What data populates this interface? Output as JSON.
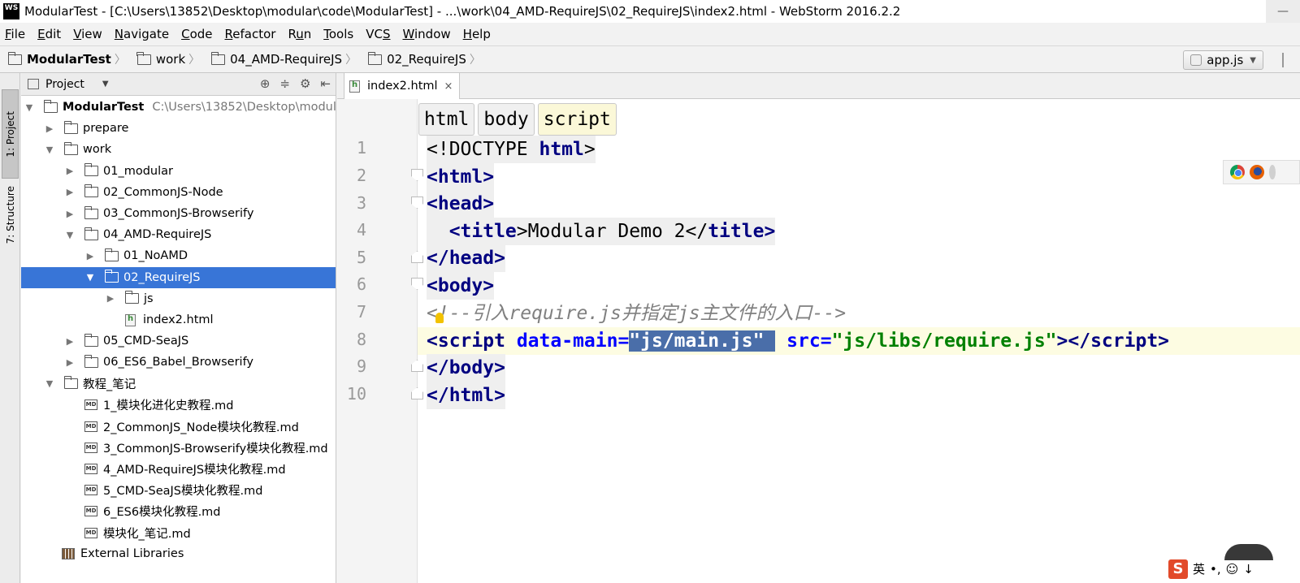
{
  "window": {
    "logo": "WS",
    "title": "ModularTest - [C:\\Users\\13852\\Desktop\\modular\\code\\ModularTest] - ...\\work\\04_AMD-RequireJS\\02_RequireJS\\index2.html - WebStorm 2016.2.2",
    "control": "—"
  },
  "menu": [
    {
      "u": "F",
      "rest": "ile"
    },
    {
      "u": "E",
      "rest": "dit"
    },
    {
      "u": "V",
      "rest": "iew"
    },
    {
      "u": "N",
      "rest": "avigate"
    },
    {
      "u": "C",
      "rest": "ode"
    },
    {
      "u": "R",
      "rest": "efactor"
    },
    {
      "pre": "R",
      "u": "u",
      "rest": "n"
    },
    {
      "u": "T",
      "rest": "ools"
    },
    {
      "pre": "VC",
      "u": "S",
      "rest": ""
    },
    {
      "u": "W",
      "rest": "indow"
    },
    {
      "u": "H",
      "rest": "elp"
    }
  ],
  "breadcrumb": [
    "ModularTest",
    "work",
    "04_AMD-RequireJS",
    "02_RequireJS"
  ],
  "run_config": "app.js",
  "toolstrip": {
    "project_tab": "1: Project",
    "structure_tab": "7: Structure"
  },
  "project_panel": {
    "title": "Project",
    "tree": [
      {
        "label": "ModularTest",
        "path": "C:\\Users\\13852\\Desktop\\modul",
        "depth": 0,
        "arrow": "▼",
        "icon": "folder",
        "bold": true
      },
      {
        "label": "prepare",
        "depth": 1,
        "arrow": "▶",
        "icon": "folder"
      },
      {
        "label": "work",
        "depth": 1,
        "arrow": "▼",
        "icon": "folder"
      },
      {
        "label": "01_modular",
        "depth": 2,
        "arrow": "▶",
        "icon": "folder"
      },
      {
        "label": "02_CommonJS-Node",
        "depth": 2,
        "arrow": "▶",
        "icon": "folder"
      },
      {
        "label": "03_CommonJS-Browserify",
        "depth": 2,
        "arrow": "▶",
        "icon": "folder"
      },
      {
        "label": "04_AMD-RequireJS",
        "depth": 2,
        "arrow": "▼",
        "icon": "folder"
      },
      {
        "label": "01_NoAMD",
        "depth": 3,
        "arrow": "▶",
        "icon": "folder"
      },
      {
        "label": "02_RequireJS",
        "depth": 3,
        "arrow": "▼",
        "icon": "folder",
        "selected": true
      },
      {
        "label": "js",
        "depth": 4,
        "arrow": "▶",
        "icon": "folder"
      },
      {
        "label": "index2.html",
        "depth": 4,
        "arrow": "",
        "icon": "html"
      },
      {
        "label": "05_CMD-SeaJS",
        "depth": 2,
        "arrow": "▶",
        "icon": "folder"
      },
      {
        "label": "06_ES6_Babel_Browserify",
        "depth": 2,
        "arrow": "▶",
        "icon": "folder"
      },
      {
        "label": "教程_笔记",
        "depth": 1,
        "arrow": "▼",
        "icon": "folder"
      },
      {
        "label": "1_模块化进化史教程.md",
        "depth": 2,
        "arrow": "",
        "icon": "md"
      },
      {
        "label": "2_CommonJS_Node模块化教程.md",
        "depth": 2,
        "arrow": "",
        "icon": "md"
      },
      {
        "label": "3_CommonJS-Browserify模块化教程.md",
        "depth": 2,
        "arrow": "",
        "icon": "md"
      },
      {
        "label": "4_AMD-RequireJS模块化教程.md",
        "depth": 2,
        "arrow": "",
        "icon": "md"
      },
      {
        "label": "5_CMD-SeaJS模块化教程.md",
        "depth": 2,
        "arrow": "",
        "icon": "md"
      },
      {
        "label": "6_ES6模块化教程.md",
        "depth": 2,
        "arrow": "",
        "icon": "md"
      },
      {
        "label": "模块化_笔记.md",
        "depth": 2,
        "arrow": "",
        "icon": "md"
      },
      {
        "label": "External Libraries",
        "depth": 0,
        "arrow": "",
        "icon": "lib"
      }
    ],
    "md_icon_text": "MD"
  },
  "editor": {
    "tab_label": "index2.html",
    "tab_close": "×",
    "xml_crumbs": [
      "html",
      "body",
      "script"
    ],
    "line_numbers": [
      "1",
      "2",
      "3",
      "4",
      "5",
      "6",
      "7",
      "8",
      "9",
      "10"
    ],
    "code": {
      "l1": {
        "a": "<!DOCTYPE ",
        "b": "html",
        "c": ">"
      },
      "l2": {
        "a": "<",
        "b": "html",
        "c": ">"
      },
      "l3": {
        "a": "<",
        "b": "head",
        "c": ">"
      },
      "l4": {
        "a": "  <",
        "b": "title",
        "c": ">Modular Demo 2</",
        "d": "title",
        "e": ">"
      },
      "l5": {
        "a": "</",
        "b": "head",
        "c": ">"
      },
      "l6": {
        "a": "<",
        "b": "body",
        "c": ">"
      },
      "l7": {
        "a": "<!--引入require.js并指定js主文件的入口-->"
      },
      "l8": {
        "a": "<",
        "b": "script",
        "c": " ",
        "d": "data-main",
        "e": "=",
        "f": "\"js/main.js\" ",
        "g": " ",
        "h": "src",
        "i": "=",
        "j": "\"js/libs/require.js\"",
        "k": "></",
        "l": "script",
        "m": ">"
      },
      "l9": {
        "a": "</",
        "b": "body",
        "c": ">"
      },
      "l10": {
        "a": "</",
        "b": "html",
        "c": ">"
      }
    }
  },
  "ime": {
    "logo": "S",
    "lang": "英",
    "punct": "•,",
    "emoji": "☺",
    "more": "↓"
  }
}
